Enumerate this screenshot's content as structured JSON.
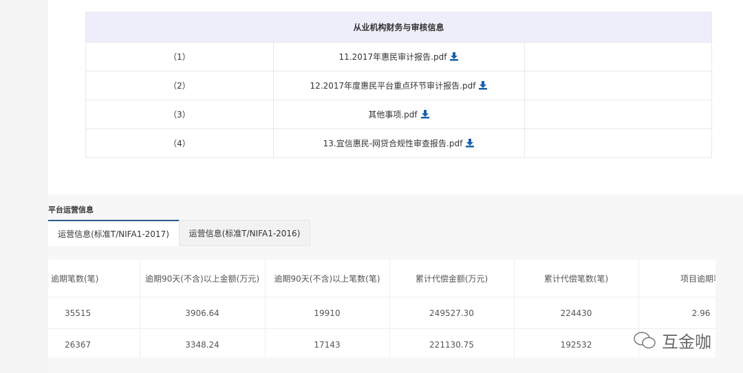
{
  "audit": {
    "title": "从业机构财务与审核信息",
    "rows": [
      {
        "num": "（1）",
        "file": "11.2017年惠民审计报告.pdf"
      },
      {
        "num": "（2）",
        "file": "12.2017年度惠民平台重点环节审计报告.pdf"
      },
      {
        "num": "（3）",
        "file": "其他事项.pdf"
      },
      {
        "num": "（4）",
        "file": "13.宜信惠民-网贷合规性审查报告.pdf"
      }
    ]
  },
  "ops": {
    "title": "平台运营信息",
    "tabs": [
      "运营信息(标准T/NIFA1-2017)",
      "运营信息(标准T/NIFA1-2016)"
    ],
    "headers": [
      "逾期笔数(笔)",
      "逾期90天(不含)以上金额(万元)",
      "逾期90天(不含)以上笔数(笔)",
      "累计代偿金额(万元)",
      "累计代偿笔数(笔)",
      "项目逾期率"
    ],
    "rows": [
      [
        "35515",
        "3906.64",
        "19910",
        "249527.30",
        "224430",
        "2.96"
      ],
      [
        "26367",
        "3348.24",
        "17143",
        "221130.75",
        "192532",
        ""
      ]
    ]
  },
  "watermark": "互金咖",
  "colors": {
    "header_bg": "#eeeefb",
    "download": "#1a5fa8",
    "tab_active": "#2a5a8a"
  }
}
